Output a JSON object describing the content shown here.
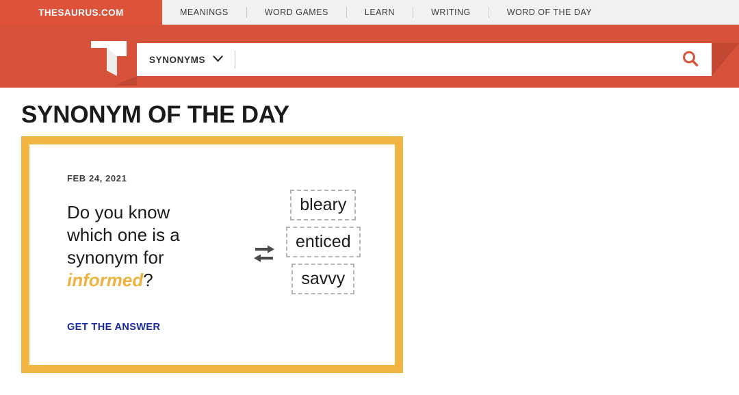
{
  "nav": {
    "brand": "THESAURUS.COM",
    "items": [
      {
        "label": "MEANINGS"
      },
      {
        "label": "WORD GAMES"
      },
      {
        "label": "LEARN"
      },
      {
        "label": "WRITING"
      },
      {
        "label": "WORD OF THE DAY"
      }
    ]
  },
  "search": {
    "logo_icon": "thesaurus-t-logo-icon",
    "selected_type": "SYNONYMS",
    "dropdown_icon": "chevron-down-icon",
    "value": "",
    "placeholder": "",
    "button_icon": "search-icon"
  },
  "page": {
    "title": "SYNONYM OF THE DAY"
  },
  "card": {
    "date": "FEB 24, 2021",
    "question_prefix": "Do you know which one is a synonym for ",
    "question_keyword": "informed",
    "question_suffix": "?",
    "swap_icon": "swap-horizontal-icon",
    "choices": [
      {
        "label": "bleary"
      },
      {
        "label": "enticed"
      },
      {
        "label": "savvy"
      }
    ],
    "answer_link": "GET THE ANSWER"
  },
  "colors": {
    "brand_orange": "#d8513a",
    "nav_bg": "#f1f1f1",
    "card_border_gold": "#f2b541",
    "keyword_gold": "#f0b23f",
    "link_blue": "#1a2a9c",
    "choice_border": "#b5b5b5"
  }
}
